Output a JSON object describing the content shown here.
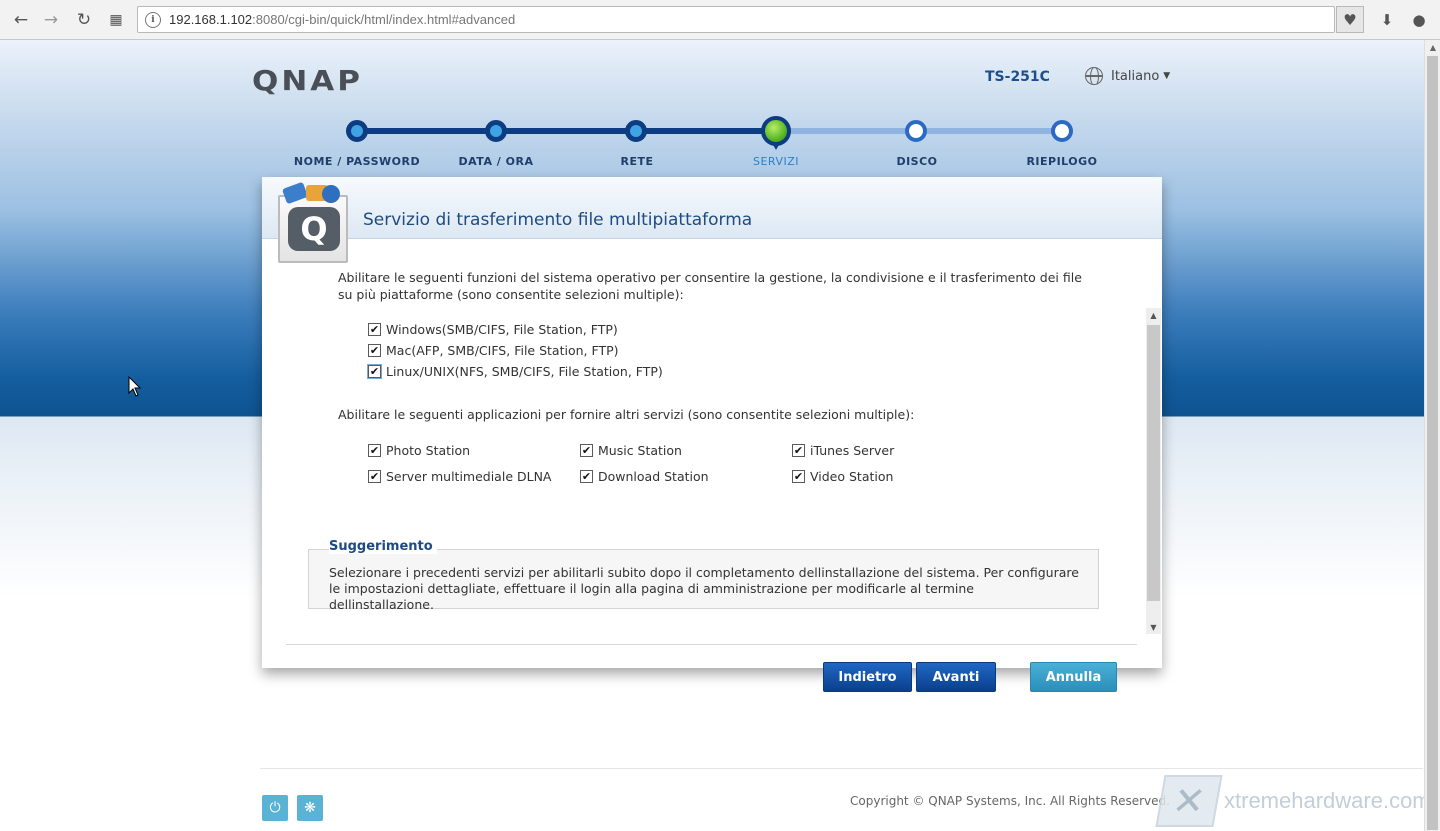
{
  "browser": {
    "url_host": "192.168.1.102",
    "url_rest": ":8080/cgi-bin/quick/html/index.html#advanced",
    "back_icon": "arrow-left-icon",
    "forward_icon": "arrow-right-icon",
    "reload_icon": "reload-icon",
    "apps_icon": "grid-icon"
  },
  "header": {
    "logo": "QNAP",
    "model": "TS-251C",
    "language": "Italiano"
  },
  "steps": [
    {
      "label": "NOME / PASSWORD",
      "state": "done"
    },
    {
      "label": "DATA / ORA",
      "state": "done"
    },
    {
      "label": "RETE",
      "state": "done"
    },
    {
      "label": "SERVIZI",
      "state": "current"
    },
    {
      "label": "DISCO",
      "state": "todo"
    },
    {
      "label": "RIEPILOGO",
      "state": "todo"
    }
  ],
  "dialog": {
    "title": "Servizio di trasferimento file multipiattaforma",
    "intro": "Abilitare le seguenti funzioni del sistema operativo per consentire la gestione, la condivisione e il trasferimento dei file su più piattaforme (sono consentite selezioni multiple):",
    "os_options": [
      {
        "label": "Windows(SMB/CIFS, File Station, FTP)",
        "checked": true
      },
      {
        "label": "Mac(AFP, SMB/CIFS, File Station, FTP)",
        "checked": true
      },
      {
        "label": "Linux/UNIX(NFS, SMB/CIFS, File Station, FTP)",
        "checked": true
      }
    ],
    "apps_intro": "Abilitare le seguenti applicazioni per fornire altri servizi (sono consentite selezioni multiple):",
    "app_options": [
      {
        "label": "Photo Station",
        "checked": true
      },
      {
        "label": "Music Station",
        "checked": true
      },
      {
        "label": "iTunes Server",
        "checked": true
      },
      {
        "label": "Server multimediale DLNA",
        "checked": true
      },
      {
        "label": "Download Station",
        "checked": true
      },
      {
        "label": "Video Station",
        "checked": true
      }
    ],
    "hint_title": "Suggerimento",
    "hint_text": "Selezionare i precedenti servizi per abilitarli subito dopo il completamento dellinstallazione del sistema. Per configurare le impostazioni dettagliate, effettuare il login alla pagina di amministrazione per modificarle al termine dellinstallazione.",
    "buttons": {
      "back": "Indietro",
      "next": "Avanti",
      "cancel": "Annulla"
    }
  },
  "footer": {
    "copyright": "Copyright © QNAP Systems, Inc. All Rights Reserved.",
    "watermark": "xtremehardware.com"
  },
  "colors": {
    "accent_dark": "#0e3c80",
    "accent_light": "#8fb4e0",
    "current_step": "#4cae1a",
    "button_primary": "#0b3f8c",
    "button_secondary": "#2a8fba"
  }
}
